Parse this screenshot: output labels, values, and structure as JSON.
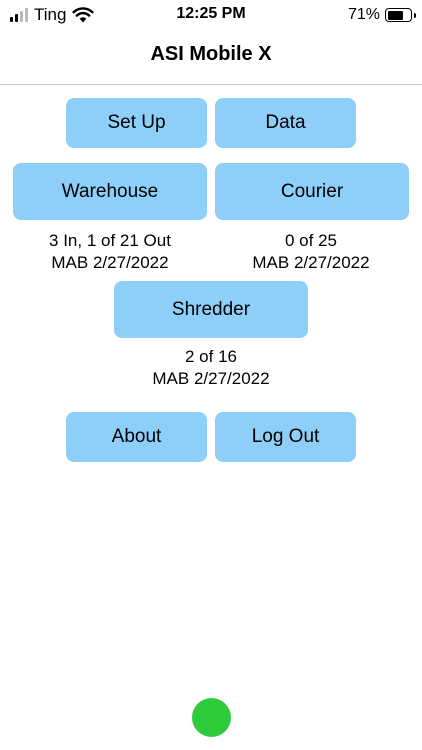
{
  "status_bar": {
    "carrier": "Ting",
    "time": "12:25 PM",
    "battery_percent": "71%",
    "battery_level": 0.71,
    "signal_bars_active": 2,
    "signal_bars_total": 4
  },
  "header": {
    "title": "ASI Mobile X"
  },
  "buttons": {
    "setup": "Set Up",
    "data": "Data",
    "warehouse": "Warehouse",
    "courier": "Courier",
    "shredder": "Shredder",
    "about": "About",
    "logout": "Log Out"
  },
  "warehouse_info": {
    "count": "3 In, 1 of 21 Out",
    "user_date": "MAB 2/27/2022"
  },
  "courier_info": {
    "count": "0 of 25",
    "user_date": "MAB 2/27/2022"
  },
  "shredder_info": {
    "count": "2 of 16",
    "user_date": "MAB 2/27/2022"
  },
  "colors": {
    "button_bg": "#8dcff8",
    "indicator": "#2ecc3a",
    "divider": "#c8c8c8"
  }
}
